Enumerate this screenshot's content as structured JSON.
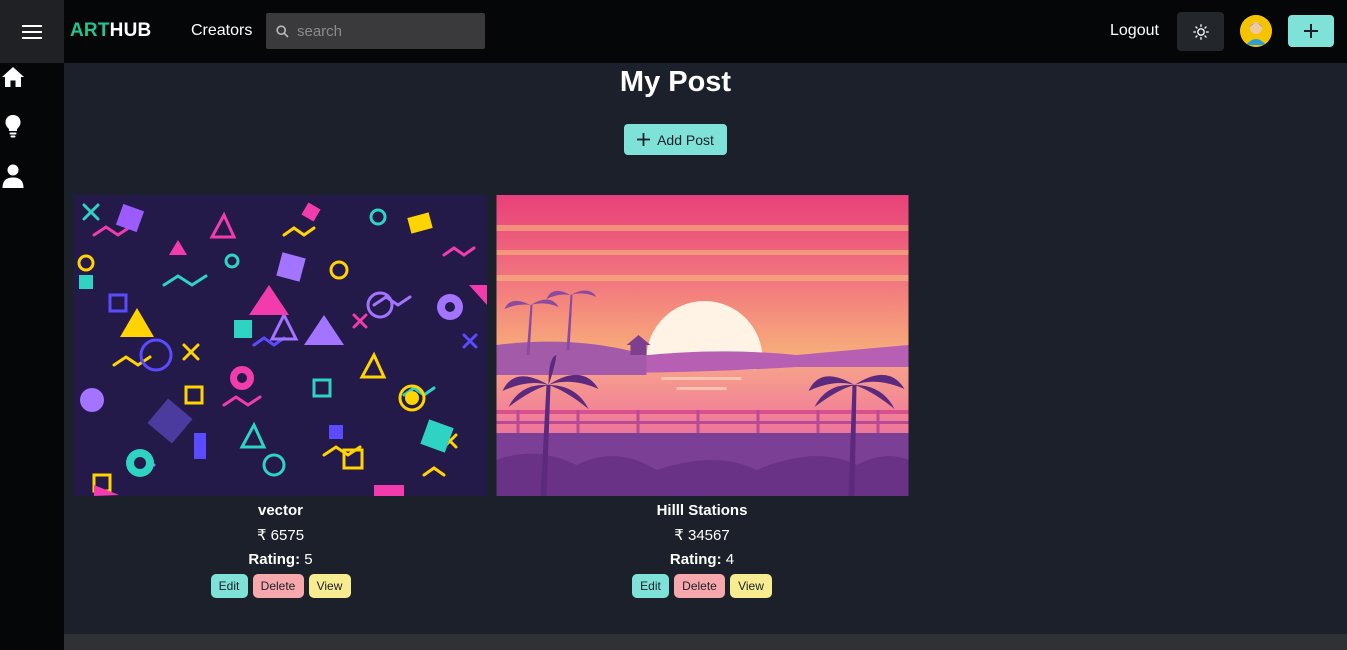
{
  "header": {
    "brand_part1": "ART",
    "brand_part2": "HUB",
    "nav_creators": "Creators",
    "search_placeholder": "search",
    "logout": "Logout",
    "menu_icon": "hamburger-icon",
    "theme_icon": "sun-icon",
    "add_icon": "plus-icon"
  },
  "sidebar": {
    "items": [
      {
        "icon": "home-icon"
      },
      {
        "icon": "lightbulb-icon"
      },
      {
        "icon": "user-icon"
      }
    ]
  },
  "main": {
    "title": "My Post",
    "add_post_label": "Add Post"
  },
  "posts": [
    {
      "name": "vector",
      "price": "₹ 6575",
      "rating_label": "Rating:",
      "rating_value": "5",
      "edit": "Edit",
      "delete": "Delete",
      "view": "View"
    },
    {
      "name": "Hilll Stations",
      "price": "₹ 34567",
      "rating_label": "Rating:",
      "rating_value": "4",
      "edit": "Edit",
      "delete": "Delete",
      "view": "View"
    }
  ],
  "colors": {
    "accent": "#7fe2d8",
    "brand_green": "#22c58e",
    "delete": "#f7a8ad",
    "view": "#f8ec90",
    "background": "#1c202a"
  }
}
